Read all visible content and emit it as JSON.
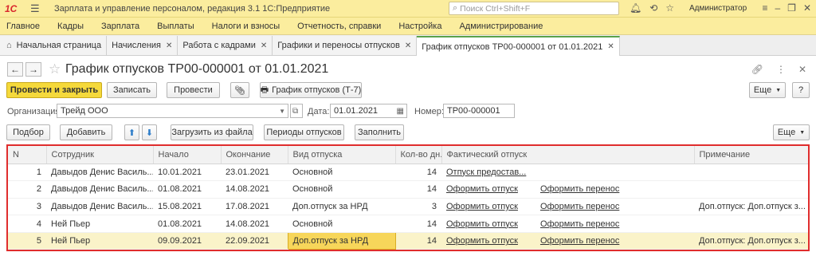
{
  "app": {
    "logo": "1С",
    "title": "Зарплата и управление персоналом, редакция 3.1 1С:Предприятие",
    "search_placeholder": "Поиск Ctrl+Shift+F",
    "user": "Администратор"
  },
  "menu": [
    "Главное",
    "Кадры",
    "Зарплата",
    "Выплаты",
    "Налоги и взносы",
    "Отчетность, справки",
    "Настройка",
    "Администрирование"
  ],
  "tabs": {
    "home": "Начальная страница",
    "items": [
      "Начисления",
      "Работа с кадрами",
      "Графики и переносы отпусков",
      "График отпусков ТР00-000001 от 01.01.2021"
    ]
  },
  "form": {
    "title": "График отпусков ТР00-000001 от 01.01.2021",
    "post_close": "Провести и закрыть",
    "save": "Записать",
    "post": "Провести",
    "print_button": "График отпусков (Т-7)",
    "more": "Еще",
    "help": "?",
    "org_label": "Организация:",
    "org_value": "Трейд ООО",
    "date_label": "Дата:",
    "date_value": "01.01.2021",
    "number_label": "Номер:",
    "number_value": "ТР00-000001"
  },
  "table_toolbar": {
    "select": "Подбор",
    "add": "Добавить",
    "load_file": "Загрузить из файла",
    "periods": "Периоды отпусков",
    "fill": "Заполнить",
    "more": "Еще"
  },
  "table": {
    "columns": [
      "N",
      "Сотрудник",
      "Начало",
      "Окончание",
      "Вид отпуска",
      "Кол-во дн.",
      "Фактический отпуск",
      "Примечание"
    ],
    "rows": [
      {
        "n": "1",
        "employee": "Давыдов Денис Василь...",
        "start": "10.01.2021",
        "end": "23.01.2021",
        "type": "Основной",
        "days": "14",
        "actual": "Отпуск предостав...",
        "transfer": "",
        "note": ""
      },
      {
        "n": "2",
        "employee": "Давыдов Денис Василь...",
        "start": "01.08.2021",
        "end": "14.08.2021",
        "type": "Основной",
        "days": "14",
        "actual": "Оформить отпуск",
        "transfer": "Оформить перенос",
        "note": ""
      },
      {
        "n": "3",
        "employee": "Давыдов Денис Василь...",
        "start": "15.08.2021",
        "end": "17.08.2021",
        "type": "Доп.отпуск за НРД",
        "days": "3",
        "actual": "Оформить отпуск",
        "transfer": "Оформить перенос",
        "note": "Доп.отпуск: Доп.отпуск з..."
      },
      {
        "n": "4",
        "employee": "Ней Пьер",
        "start": "01.08.2021",
        "end": "14.08.2021",
        "type": "Основной",
        "days": "14",
        "actual": "Оформить отпуск",
        "transfer": "Оформить перенос",
        "note": ""
      },
      {
        "n": "5",
        "employee": "Ней Пьер",
        "start": "09.09.2021",
        "end": "22.09.2021",
        "type": "Доп.отпуск за НРД",
        "days": "14",
        "actual": "Оформить отпуск",
        "transfer": "Оформить перенос",
        "note": "Доп.отпуск: Доп.отпуск з..."
      }
    ]
  }
}
